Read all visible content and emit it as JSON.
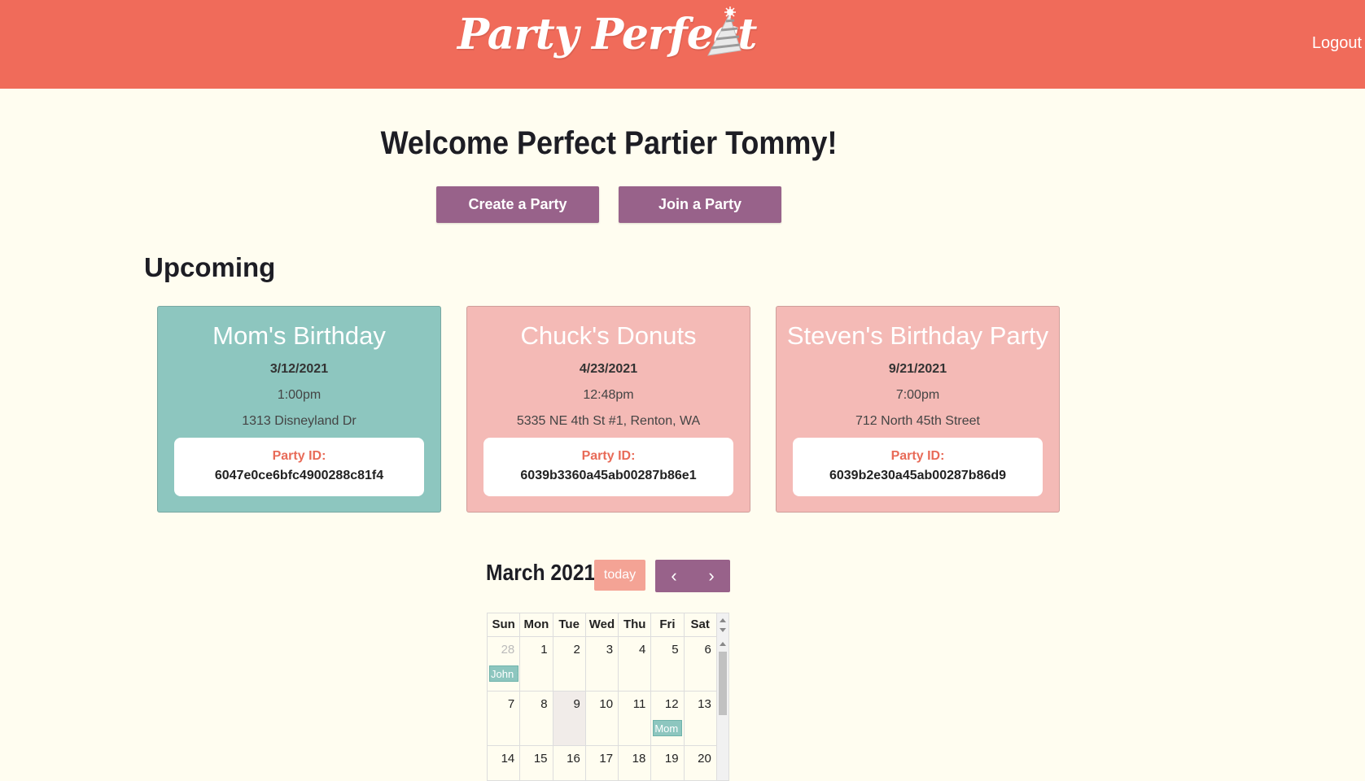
{
  "app": {
    "title": "Party Perfect",
    "logout_label": "Logout"
  },
  "welcome": {
    "heading": "Welcome Perfect Partier Tommy!"
  },
  "actions": {
    "create_label": "Create a Party",
    "join_label": "Join a Party"
  },
  "upcoming": {
    "heading": "Upcoming",
    "id_label": "Party ID:",
    "cards": [
      {
        "title": "Mom's Birthday",
        "date": "3/12/2021",
        "time": "1:00pm",
        "location": "1313 Disneyland Dr",
        "party_id": "6047e0ce6bfc4900288c81f4"
      },
      {
        "title": "Chuck's Donuts",
        "date": "4/23/2021",
        "time": "12:48pm",
        "location": "5335 NE 4th St #1, Renton, WA",
        "party_id": "6039b3360a45ab00287b86e1"
      },
      {
        "title": "Steven's Birthday Party",
        "date": "9/21/2021",
        "time": "7:00pm",
        "location": "712 North 45th Street",
        "party_id": "6039b2e30a45ab00287b86d9"
      }
    ]
  },
  "calendar": {
    "title": "March 2021",
    "today_label": "today",
    "prev_icon": "‹",
    "next_icon": "›",
    "weekdays": [
      "Sun",
      "Mon",
      "Tue",
      "Wed",
      "Thu",
      "Fri",
      "Sat"
    ],
    "weeks": [
      [
        "28",
        "1",
        "2",
        "3",
        "4",
        "5",
        "6"
      ],
      [
        "7",
        "8",
        "9",
        "10",
        "11",
        "12",
        "13"
      ],
      [
        "14",
        "15",
        "16",
        "17",
        "18",
        "19",
        "20"
      ]
    ],
    "events": [
      {
        "label": "John :"
      },
      {
        "label": "Mom"
      }
    ]
  },
  "colors": {
    "header": "#f06b5a",
    "accent": "#98628a",
    "teal": "#8dc6bf",
    "pink": "#f4bab6",
    "background": "#fffdf0"
  }
}
